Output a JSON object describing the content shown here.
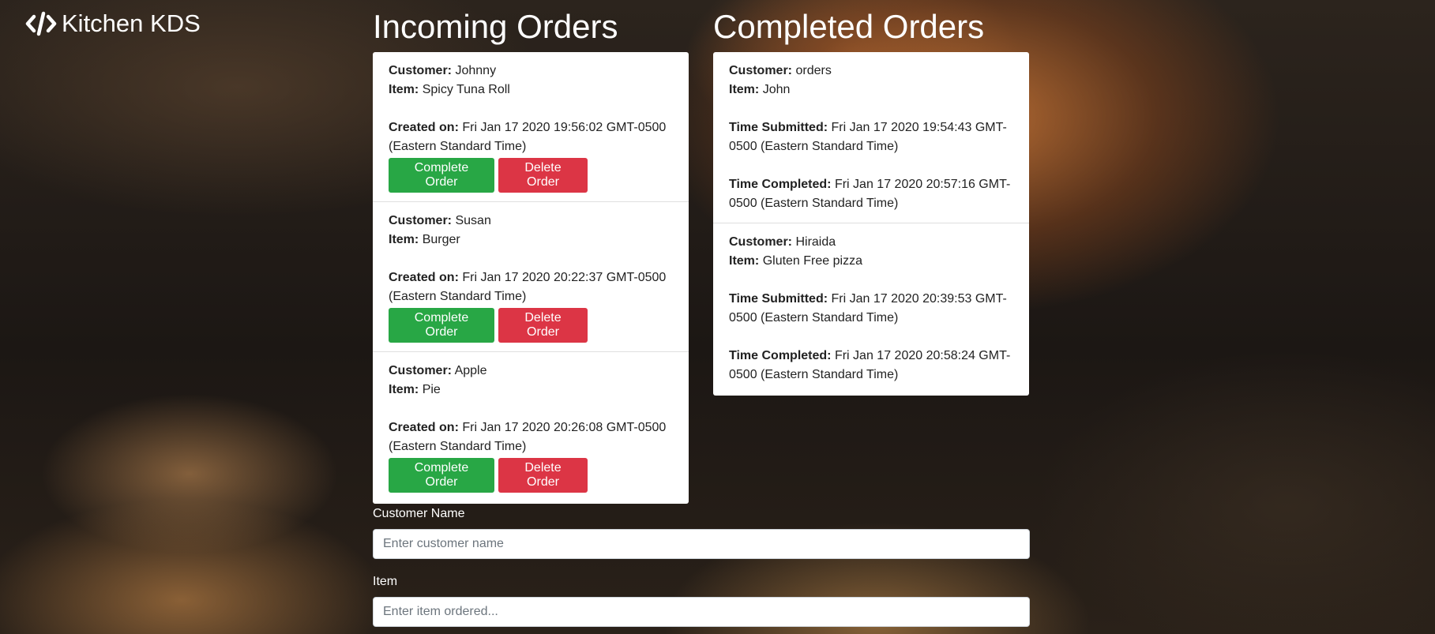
{
  "brand": {
    "name": "Kitchen KDS",
    "icon": "code-icon"
  },
  "incoming": {
    "title": "Incoming Orders",
    "labels": {
      "customer": "Customer:",
      "item": "Item:",
      "created": "Created on:"
    },
    "orders": [
      {
        "customer": "Johnny",
        "item": "Spicy Tuna Roll",
        "created_line1": "Fri Jan 17 2020 19:56:02 GMT-0500",
        "created_line2": "(Eastern Standard Time)"
      },
      {
        "customer": "Susan",
        "item": "Burger",
        "created_line1": "Fri Jan 17 2020 20:22:37 GMT-0500",
        "created_line2": "(Eastern Standard Time)"
      },
      {
        "customer": "Apple",
        "item": "Pie",
        "created_line1": "Fri Jan 17 2020 20:26:08 GMT-0500",
        "created_line2": "(Eastern Standard Time)"
      }
    ],
    "complete_label": "Complete Order",
    "delete_label": "Delete Order"
  },
  "completed": {
    "title": "Completed Orders",
    "labels": {
      "customer": "Customer:",
      "item": "Item:",
      "submitted": "Time Submitted:",
      "completed": "Time Completed:"
    },
    "orders": [
      {
        "customer": "orders",
        "item": "John",
        "submitted_line1": "Fri Jan 17 2020 19:54:43 GMT-",
        "submitted_line2": "0500 (Eastern Standard Time)",
        "completed_line1": "Fri Jan 17 2020 20:57:16 GMT-",
        "completed_line2": "0500 (Eastern Standard Time)"
      },
      {
        "customer": "Hiraida",
        "item": "Gluten Free pizza",
        "submitted_line1": "Fri Jan 17 2020 20:39:53 GMT-",
        "submitted_line2": "0500 (Eastern Standard Time)",
        "completed_line1": "Fri Jan 17 2020 20:58:24 GMT-",
        "completed_line2": "0500 (Eastern Standard Time)"
      }
    ]
  },
  "form": {
    "customer_label": "Customer Name",
    "customer_placeholder": "Enter customer name",
    "customer_value": "",
    "item_label": "Item",
    "item_placeholder": "Enter item ordered...",
    "item_value": ""
  },
  "colors": {
    "complete_button": "#28a745",
    "delete_button": "#dc3545",
    "panel_background": "#ffffff"
  }
}
